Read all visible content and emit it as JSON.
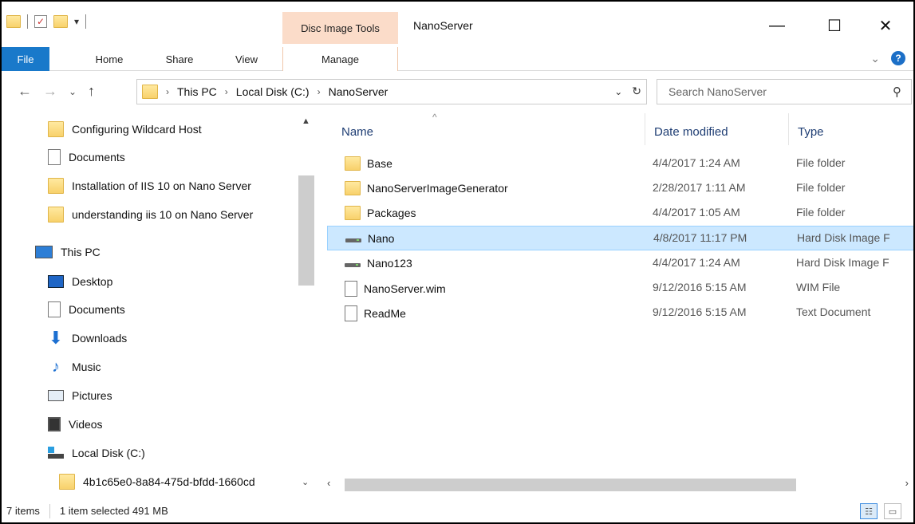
{
  "window": {
    "title": "NanoServer",
    "context_tab": "Disc Image Tools",
    "min_icon": "—",
    "max_icon": "☐",
    "close_icon": "✕"
  },
  "ribbon": {
    "tabs": [
      "File",
      "Home",
      "Share",
      "View",
      "Manage"
    ],
    "collapse_icon": "⌄",
    "help_icon": "?"
  },
  "address": {
    "crumbs": [
      "This PC",
      "Local Disk (C:)",
      "NanoServer"
    ],
    "search_placeholder": "Search NanoServer"
  },
  "nav": {
    "items": [
      {
        "label": "Configuring Wildcard Host",
        "icon": "folder-icon"
      },
      {
        "label": "Documents",
        "icon": "document-icon"
      },
      {
        "label": "Installation of IIS 10 on Nano Server",
        "icon": "folder-icon"
      },
      {
        "label": "understanding iis 10 on Nano Server",
        "icon": "folder-icon"
      },
      {
        "label": "This PC",
        "icon": "computer-icon"
      },
      {
        "label": "Desktop",
        "icon": "desktop-icon"
      },
      {
        "label": "Documents",
        "icon": "document-icon"
      },
      {
        "label": "Downloads",
        "icon": "download-icon"
      },
      {
        "label": "Music",
        "icon": "music-icon"
      },
      {
        "label": "Pictures",
        "icon": "pictures-icon"
      },
      {
        "label": "Videos",
        "icon": "videos-icon"
      },
      {
        "label": "Local Disk (C:)",
        "icon": "local-disk-icon"
      },
      {
        "label": "4b1c65e0-8a84-475d-bfdd-1660cd",
        "icon": "folder-icon"
      }
    ]
  },
  "columns": {
    "name": "Name",
    "date": "Date modified",
    "type": "Type"
  },
  "files": [
    {
      "name": "Base",
      "date": "4/4/2017 1:24 AM",
      "type": "File folder",
      "icon": "folder-icon"
    },
    {
      "name": "NanoServerImageGenerator",
      "date": "2/28/2017 1:11 AM",
      "type": "File folder",
      "icon": "folder-icon"
    },
    {
      "name": "Packages",
      "date": "4/4/2017 1:05 AM",
      "type": "File folder",
      "icon": "folder-icon"
    },
    {
      "name": "Nano",
      "date": "4/8/2017 11:17 PM",
      "type": "Hard Disk Image F",
      "icon": "disk-image-icon",
      "selected": true
    },
    {
      "name": "Nano123",
      "date": "4/4/2017 1:24 AM",
      "type": "Hard Disk Image F",
      "icon": "disk-image-icon"
    },
    {
      "name": "NanoServer.wim",
      "date": "9/12/2016 5:15 AM",
      "type": "WIM File",
      "icon": "file-icon"
    },
    {
      "name": "ReadMe",
      "date": "9/12/2016 5:15 AM",
      "type": "Text Document",
      "icon": "text-document-icon"
    }
  ],
  "status": {
    "count": "7 items",
    "selection": "1 item selected  491 MB"
  }
}
